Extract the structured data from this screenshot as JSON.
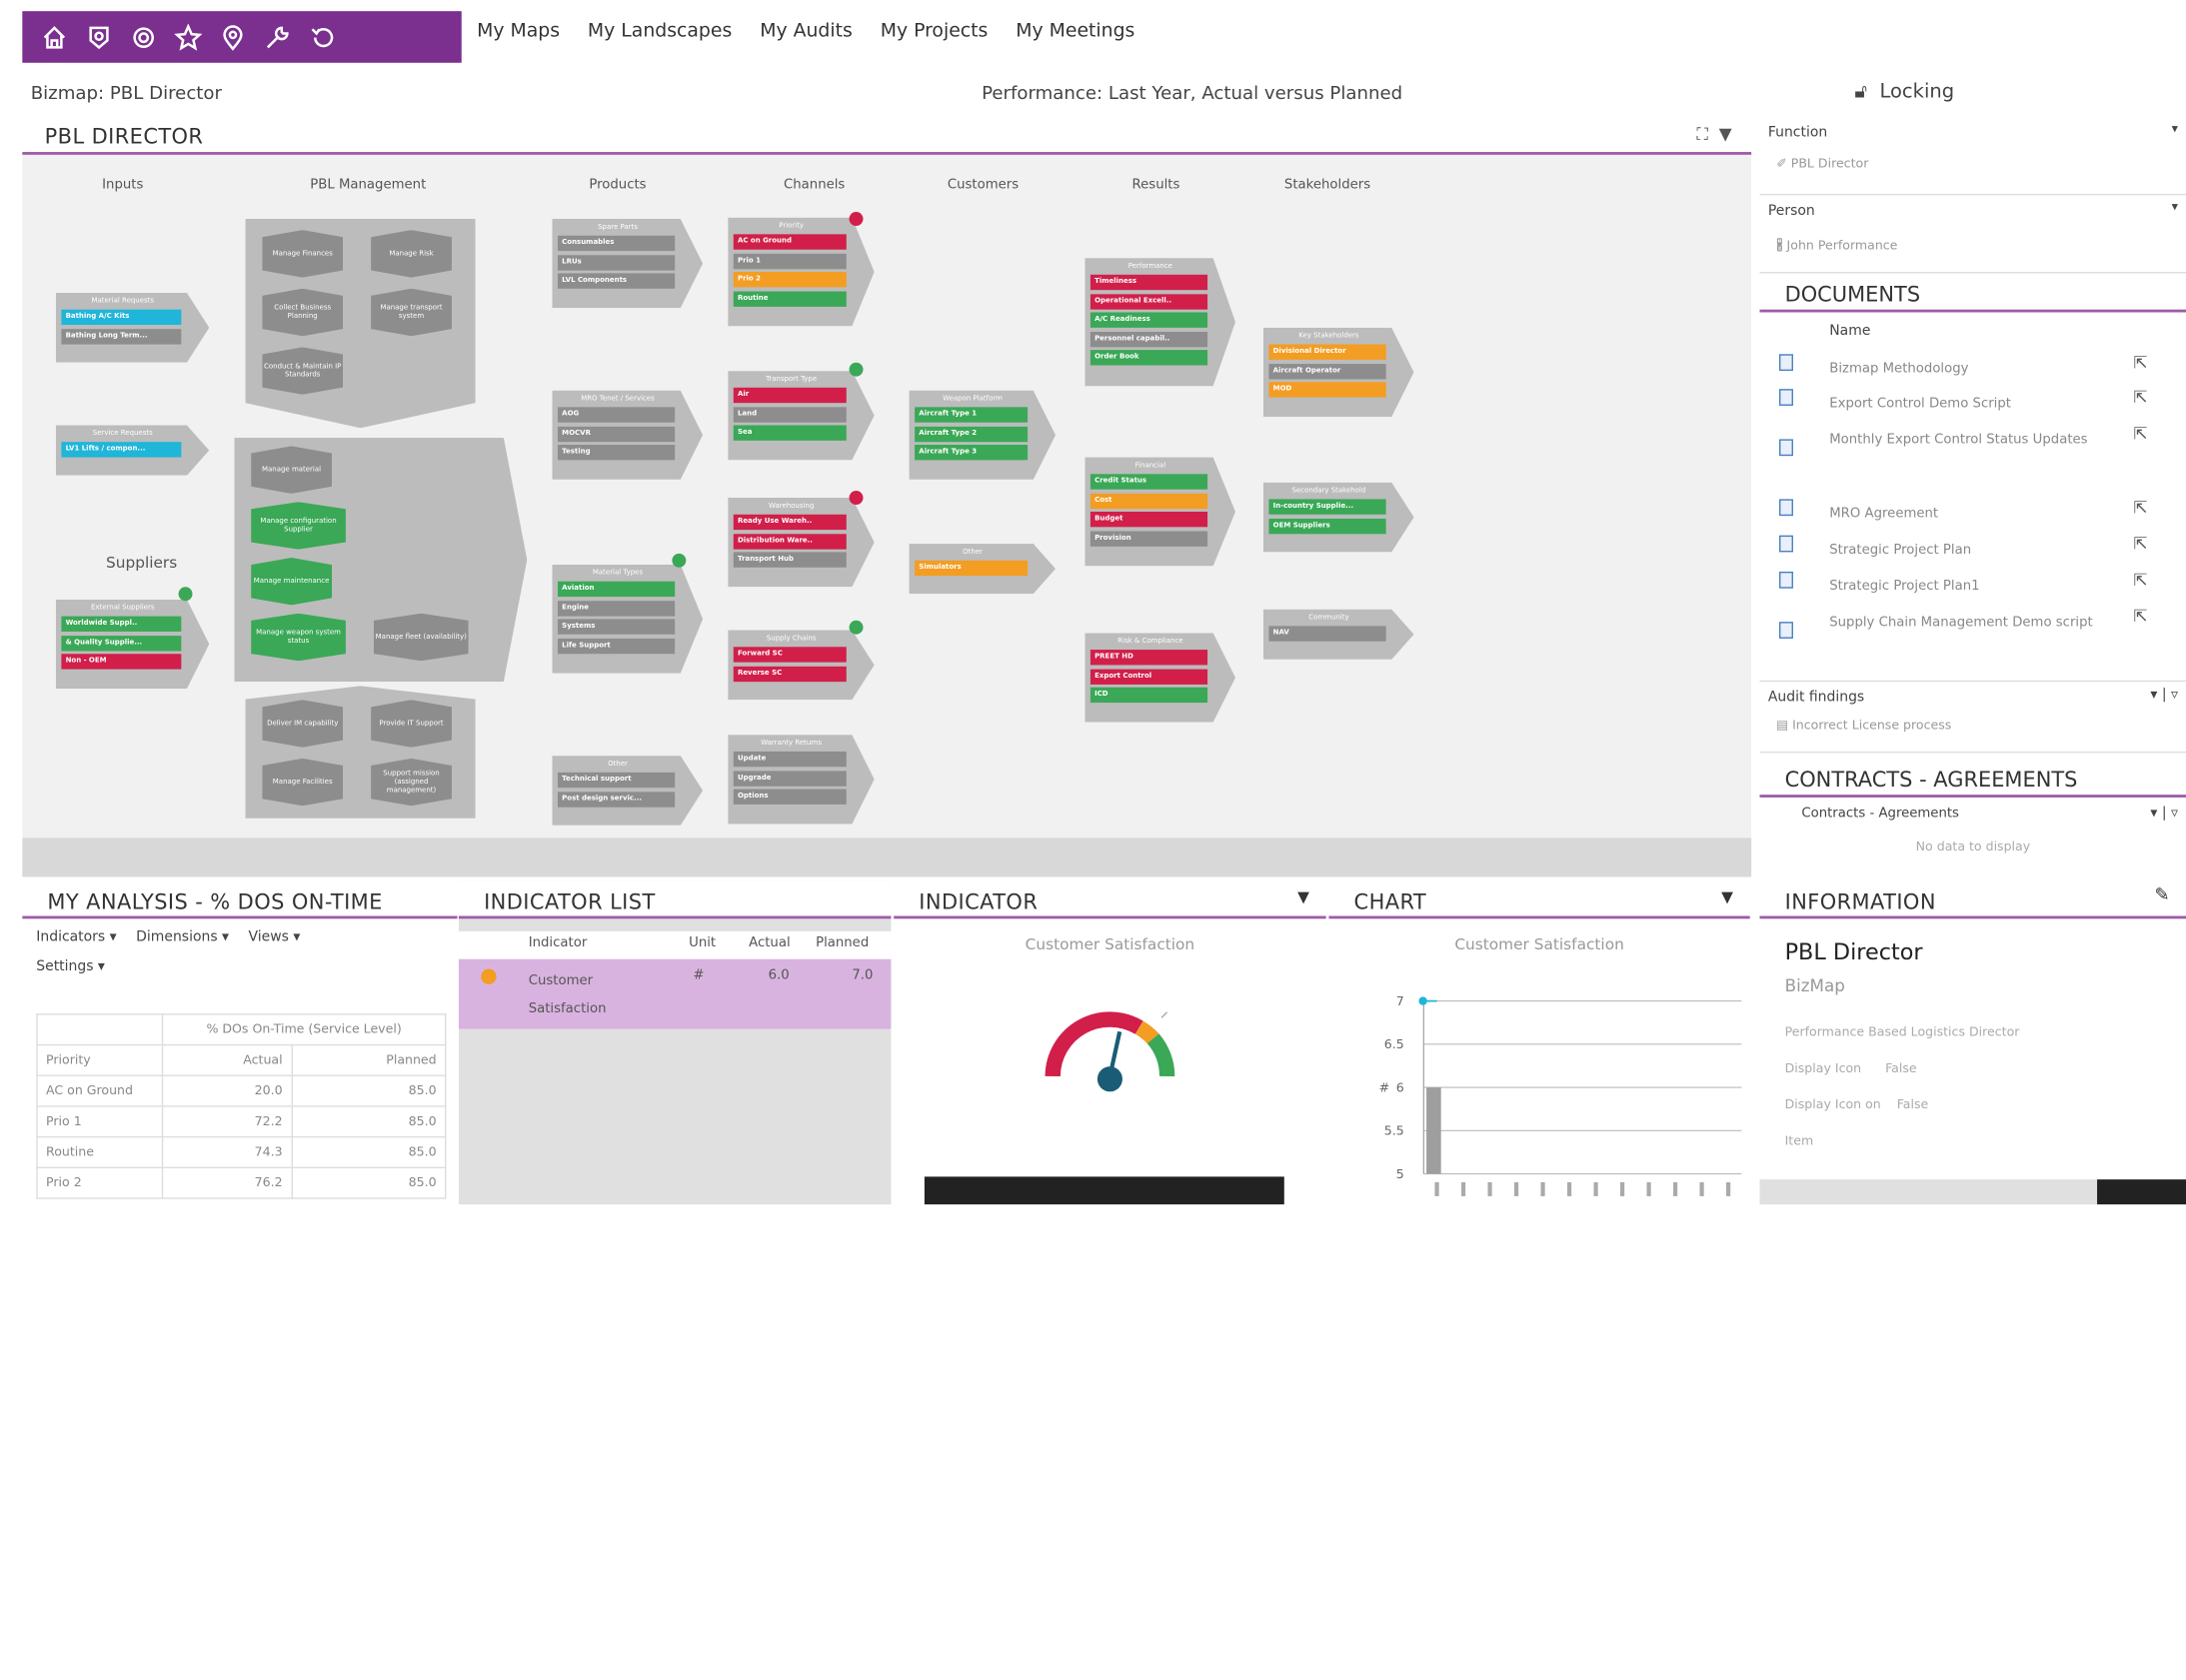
{
  "topbar": {
    "icons": [
      "home-icon",
      "shield-icon",
      "gear-icon",
      "star-icon",
      "location-icon",
      "tools-icon",
      "undo-icon"
    ]
  },
  "nav": {
    "items": [
      "My Maps",
      "My Landscapes",
      "My Audits",
      "My Projects",
      "My Meetings"
    ]
  },
  "subheader": {
    "bizmap": "Bizmap: PBL Director",
    "performance": "Performance: Last Year, Actual versus Planned",
    "locking": "Locking"
  },
  "main": {
    "title": "PBL DIRECTOR",
    "columns": [
      "Inputs",
      "PBL Management",
      "Products",
      "Channels",
      "Customers",
      "Results",
      "Stakeholders"
    ],
    "suppliers_label": "Suppliers",
    "blocks": {
      "material": {
        "title": "Material Requests",
        "items": [
          "Bathing A/C Kits",
          "Bathing Long Term..."
        ]
      },
      "service": {
        "title": "Service Requests",
        "items": [
          "LV1 Lifts / compon..."
        ]
      },
      "external": {
        "title": "External Suppliers",
        "items": [
          "Worldwide Suppl..",
          "& Quality Supplie...",
          "Non - OEM"
        ]
      },
      "spare": {
        "title": "Spare Parts",
        "items": [
          "Consumables",
          "LRUs",
          "LVL Components"
        ]
      },
      "mro": {
        "title": "MRO Tenet / Services",
        "items": [
          "AOG",
          "MOCVR",
          "Testing"
        ]
      },
      "material_types": {
        "title": "Material Types",
        "items": [
          "Aviation",
          "Engine",
          "Systems",
          "Life Support"
        ]
      },
      "other_products": {
        "title": "Other",
        "items": [
          "Technical support",
          "Post design servic..."
        ]
      },
      "priority": {
        "title": "Priority",
        "items": [
          "AC on Ground",
          "Prio 1",
          "Prio 2",
          "Routine"
        ]
      },
      "transport": {
        "title": "Transport Type",
        "items": [
          "Air",
          "Land",
          "Sea"
        ]
      },
      "warehousing": {
        "title": "Warehousing",
        "items": [
          "Ready Use Wareh..",
          "Distribution Ware..",
          "Transport Hub"
        ]
      },
      "supply_chain": {
        "title": "Supply Chains",
        "items": [
          "Forward SC",
          "Reverse SC"
        ]
      },
      "warranty": {
        "title": "Warranty Returns",
        "items": [
          "Update",
          "Upgrade",
          "Options"
        ]
      },
      "weapon": {
        "title": "Weapon Platform",
        "items": [
          "Aircraft Type 1",
          "Aircraft Type 2",
          "Aircraft Type 3"
        ]
      },
      "other_customers": {
        "title": "Other",
        "items": [
          "Simulators"
        ]
      },
      "performance": {
        "title": "Performance",
        "items": [
          "Timeliness",
          "Operational Excell..",
          "A/C Readiness",
          "Personnel capabil..",
          "Order Book"
        ]
      },
      "financial": {
        "title": "Financial",
        "items": [
          "Credit Status",
          "Cost",
          "Budget",
          "Provision"
        ]
      },
      "risk": {
        "title": "Risk & Compliance",
        "items": [
          "PREET HD",
          "Export Control",
          "ICD"
        ]
      },
      "key_stake": {
        "title": "Key Stakeholders",
        "items": [
          "Divisional Director",
          "Aircraft Operator",
          "MOD"
        ]
      },
      "industry": {
        "title": "Secondary Stakehold",
        "items": [
          "In-country Supplie...",
          "OEM Suppliers"
        ]
      },
      "community": {
        "title": "Community",
        "items": [
          "NAV"
        ]
      }
    },
    "mgmt": {
      "top": [
        "Manage Finances",
        "Manage Risk",
        "Collect Business Planning",
        "Manage transport system",
        "Conduct & Maintain IP Standards"
      ],
      "mid": [
        "Manage material",
        "Manage configuration Supplier",
        "Manage maintenance",
        "Manage weapon system status",
        "Manage fleet (availability)"
      ],
      "bottom": [
        "Deliver IM capability",
        "Provide IT Support",
        "Manage Facilities",
        "Support mission (assigned management)"
      ]
    }
  },
  "right": {
    "function_label": "Function",
    "function_value": "PBL Director",
    "person_label": "Person",
    "person_value": "John Performance",
    "documents_title": "DOCUMENTS",
    "documents_col": "Name",
    "documents": [
      "Bizmap Methodology",
      "Export Control Demo Script",
      "Monthly Export Control Status Updates",
      "MRO Agreement",
      "Strategic Project Plan",
      "Strategic Project Plan1",
      "Supply Chain Management Demo script"
    ],
    "audit_label": "Audit findings",
    "audit_value": "Incorrect License process",
    "contracts_title": "CONTRACTS - AGREEMENTS",
    "contracts_label": "Contracts - Agreements",
    "contracts_empty": "No data to display"
  },
  "analysis": {
    "title": "MY ANALYSIS - % DOS ON-TIME",
    "menus": [
      "Indicators ▾",
      "Dimensions ▾",
      "Views ▾",
      "Settings ▾"
    ],
    "table_header": "% DOs On-Time (Service Level)",
    "cols": [
      "Priority",
      "Actual",
      "Planned"
    ],
    "rows": [
      [
        "AC on Ground",
        "20.0",
        "85.0"
      ],
      [
        "Prio 1",
        "72.2",
        "85.0"
      ],
      [
        "Routine",
        "74.3",
        "85.0"
      ],
      [
        "Prio 2",
        "76.2",
        "85.0"
      ]
    ]
  },
  "indicator_list": {
    "title": "INDICATOR LIST",
    "cols": [
      "Indicator",
      "Unit",
      "Actual",
      "Planned"
    ],
    "row": {
      "name": "Customer Satisfaction",
      "unit": "#",
      "actual": "6.0",
      "planned": "7.0"
    }
  },
  "indicator": {
    "title": "INDICATOR",
    "subtitle": "Customer Satisfaction",
    "gauge_value": 6.0,
    "gauge_target": 7.0
  },
  "chart": {
    "title": "CHART",
    "subtitle": "Customer Satisfaction"
  },
  "chart_data": {
    "type": "bar",
    "title": "Customer Satisfaction",
    "ylabel": "#",
    "ylim": [
      5,
      7
    ],
    "yticks": [
      "7",
      "6.5",
      "6",
      "5.5",
      "5"
    ],
    "categories": [
      "",
      "",
      "",
      "",
      "",
      "",
      "",
      "",
      "",
      "",
      "",
      ""
    ],
    "series": [
      {
        "type": "bar",
        "values": [
          6.0
        ]
      },
      {
        "type": "line",
        "values": [
          7.0
        ]
      }
    ]
  },
  "info": {
    "title": "INFORMATION",
    "name": "PBL Director",
    "type": "BizMap",
    "description": "Performance Based Logistics Director",
    "rows": [
      [
        "Display Icon",
        "False"
      ],
      [
        "Display Icon on",
        "False"
      ],
      [
        "Item",
        ""
      ]
    ]
  },
  "colors": {
    "purple": "#7b2f8e",
    "red": "#d11f4a",
    "green": "#3aa856",
    "orange": "#f39d22",
    "cyan": "#1fb6d9",
    "grey": "#8d8d8d"
  }
}
